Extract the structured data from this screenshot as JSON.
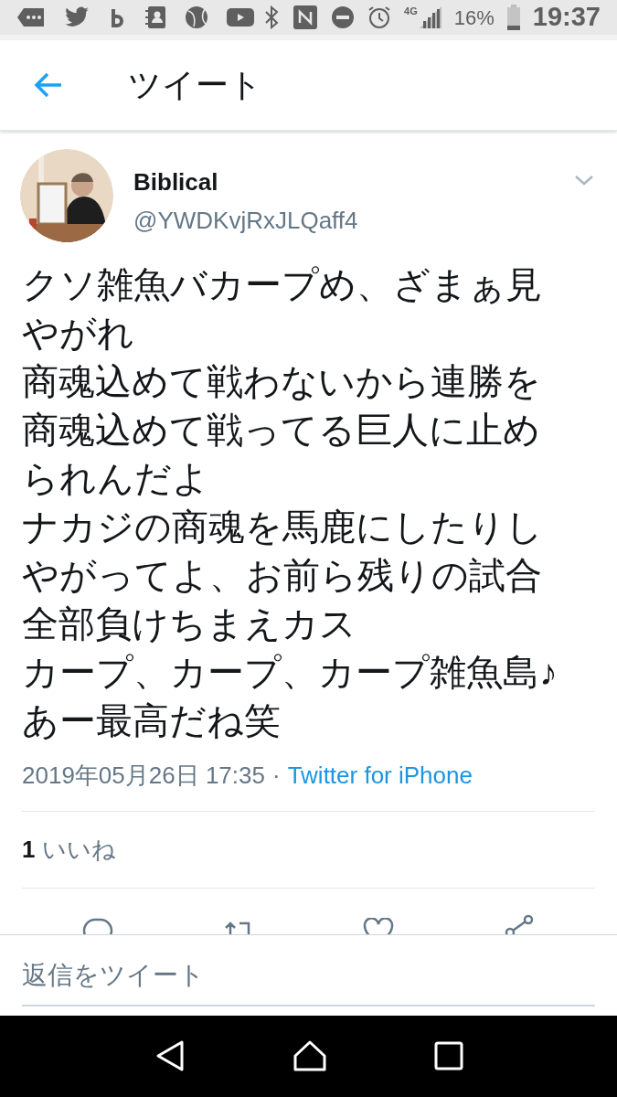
{
  "status_bar": {
    "network": "4G",
    "battery": "16%",
    "time": "19:37"
  },
  "header": {
    "title": "ツイート"
  },
  "tweet": {
    "name": "Biblical",
    "handle": "@YWDKvjRxJLQaff4",
    "lines": [
      "クソ雑魚バカープめ、ざまぁ見やがれ",
      "商魂込めて戦わないから連勝を商魂込めて戦ってる巨人に止められんだよ",
      "ナカジの商魂を馬鹿にしたりしやがってよ、お前ら残りの試合全部負けちまえカス",
      "カープ、カープ、カープ雑魚島♪",
      "あー最高だね笑"
    ],
    "date": "2019年05月26日 17:35",
    "separator": "·",
    "source": "Twitter for iPhone",
    "likes_count": "1",
    "likes_label": "いいね"
  },
  "reply_box": {
    "placeholder": "返信をツイート"
  }
}
